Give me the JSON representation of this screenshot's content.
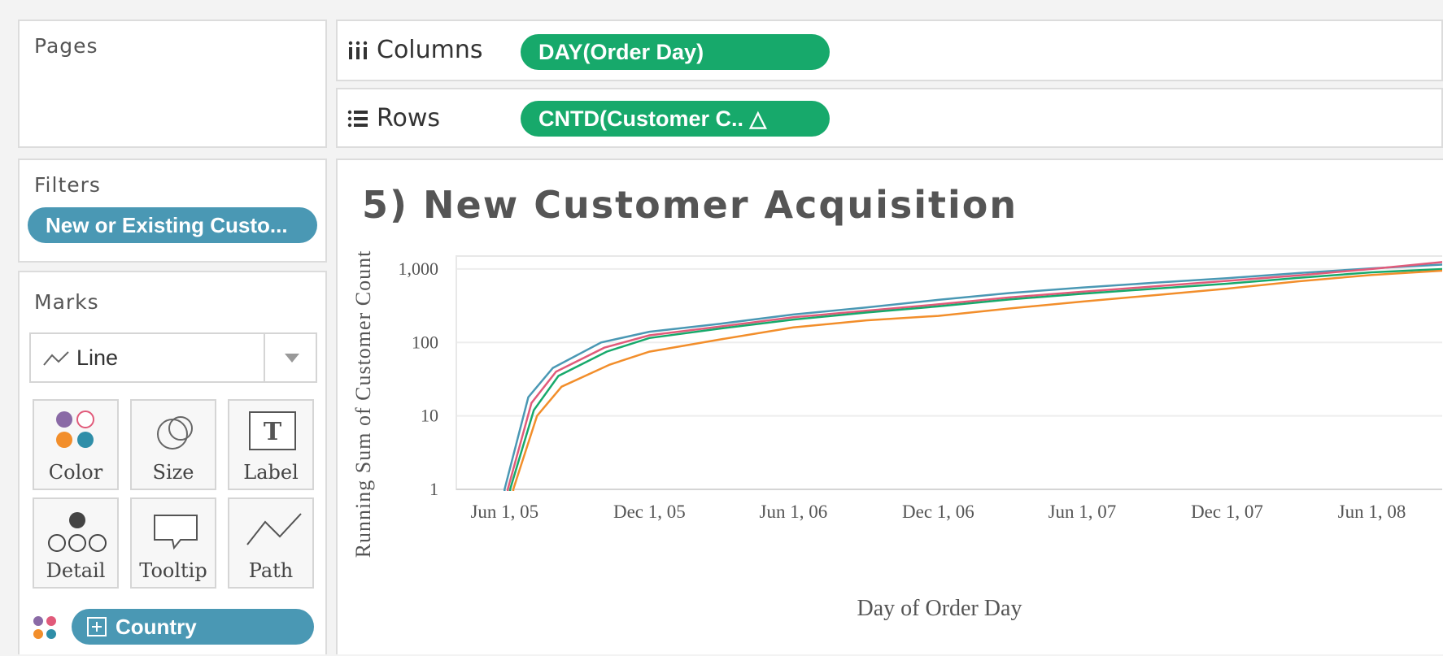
{
  "panels": {
    "pages_title": "Pages",
    "filters_title": "Filters",
    "marks_title": "Marks"
  },
  "shelves": {
    "columns_label": "Columns",
    "columns_pill": "DAY(Order Day)",
    "rows_label": "Rows",
    "rows_pill": "CNTD(Customer C.. △"
  },
  "filters": {
    "pill": "New or Existing Custo..."
  },
  "marks": {
    "type": "Line",
    "cards": [
      "Color",
      "Size",
      "Label",
      "Detail",
      "Tooltip",
      "Path"
    ],
    "dimension_pill": "Country"
  },
  "colors": {
    "green_pill": "#17a96b",
    "blue_pill": "#4a98b4",
    "series": [
      "#4a98b4",
      "#e15a7a",
      "#17a96b",
      "#f28e2b"
    ]
  },
  "chart_data": {
    "type": "line",
    "title": "5) New Customer Acquisition",
    "xlabel": "Day of Order Day",
    "ylabel": "Running Sum of Customer Count",
    "x_ticks": [
      "Jun 1, 05",
      "Dec 1, 05",
      "Jun 1, 06",
      "Dec 1, 06",
      "Jun 1, 07",
      "Dec 1, 07",
      "Jun 1, 08"
    ],
    "y_ticks": [
      "1",
      "10",
      "100",
      "1,000"
    ],
    "y_scale": "log",
    "ylim": [
      1,
      1500
    ],
    "xlim": [
      "2005-04-01",
      "2008-08-31"
    ],
    "grid": "horizontal",
    "series": [
      {
        "color": "#4a98b4",
        "x": [
          "2005-06-01",
          "2005-07-01",
          "2005-08-01",
          "2005-10-01",
          "2005-12-01",
          "2006-03-01",
          "2006-06-01",
          "2006-09-01",
          "2006-12-01",
          "2007-03-01",
          "2007-06-01",
          "2007-09-01",
          "2007-12-01",
          "2008-03-01",
          "2008-06-01",
          "2008-08-31"
        ],
        "y": [
          1,
          18,
          45,
          100,
          140,
          180,
          240,
          300,
          380,
          470,
          560,
          650,
          750,
          880,
          1020,
          1150
        ]
      },
      {
        "color": "#e15a7a",
        "x": [
          "2005-06-05",
          "2005-07-05",
          "2005-08-05",
          "2005-10-05",
          "2005-12-01",
          "2006-03-01",
          "2006-06-01",
          "2006-09-01",
          "2006-12-01",
          "2007-03-01",
          "2007-06-01",
          "2007-09-01",
          "2007-12-01",
          "2008-03-01",
          "2008-06-01",
          "2008-08-31"
        ],
        "y": [
          1,
          15,
          40,
          85,
          125,
          165,
          220,
          270,
          330,
          410,
          490,
          580,
          690,
          820,
          1000,
          1250
        ]
      },
      {
        "color": "#17a96b",
        "x": [
          "2005-06-08",
          "2005-07-08",
          "2005-08-08",
          "2005-10-08",
          "2005-12-01",
          "2006-03-01",
          "2006-06-01",
          "2006-09-01",
          "2006-12-01",
          "2007-03-01",
          "2007-06-01",
          "2007-09-01",
          "2007-12-01",
          "2008-03-01",
          "2008-06-01",
          "2008-08-31"
        ],
        "y": [
          1,
          12,
          35,
          75,
          115,
          155,
          205,
          255,
          310,
          385,
          460,
          540,
          630,
          760,
          900,
          1000
        ]
      },
      {
        "color": "#f28e2b",
        "x": [
          "2005-06-12",
          "2005-07-12",
          "2005-08-12",
          "2005-10-12",
          "2005-12-01",
          "2006-03-01",
          "2006-06-01",
          "2006-09-01",
          "2006-12-01",
          "2007-03-01",
          "2007-06-01",
          "2007-09-01",
          "2007-12-01",
          "2008-03-01",
          "2008-06-01",
          "2008-08-31"
        ],
        "y": [
          1,
          10,
          25,
          50,
          75,
          110,
          160,
          200,
          230,
          290,
          360,
          440,
          540,
          680,
          830,
          950
        ]
      }
    ]
  }
}
